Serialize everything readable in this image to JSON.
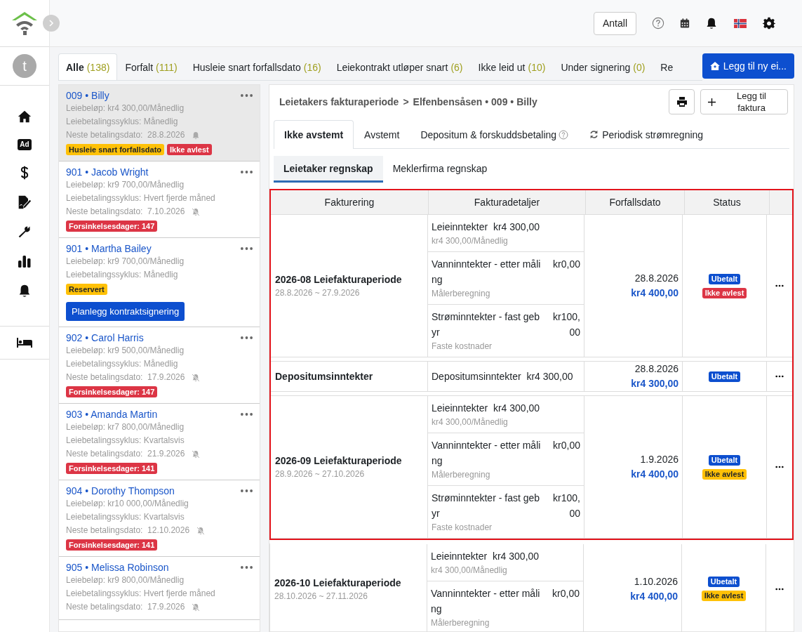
{
  "sidebar": {
    "avatar": "t",
    "ad_badge": "Ad"
  },
  "toolbar": {
    "count_button": "Antall"
  },
  "filter_tabs": [
    {
      "label": "Alle",
      "count": "(138)",
      "selected": true
    },
    {
      "label": "Forfalt",
      "count": "(111)",
      "selected": false
    },
    {
      "label": "Husleie snart forfallsdato",
      "count": "(16)",
      "selected": false
    },
    {
      "label": "Leiekontrakt utløper snart",
      "count": "(6)",
      "selected": false
    },
    {
      "label": "Ikke leid ut",
      "count": "(10)",
      "selected": false
    },
    {
      "label": "Under signering",
      "count": "(0)",
      "selected": false
    },
    {
      "label": "Re",
      "selected": false
    }
  ],
  "add_property_button": "Legg til ny ei...",
  "tenants": [
    {
      "title": "009 • Billy",
      "rent": "Leiebeløp: kr4 300,00/Månedlig",
      "cycle": "Leiebetalingssyklus: Månedlig",
      "next_payment": "Neste betalingsdato:  28.8.2026",
      "reminder": true,
      "selected": true,
      "tags": [
        {
          "label": "Husleie snart forfallsdato",
          "color": "#ffc107"
        },
        {
          "label": "Ikke avlest",
          "color": "#dc3545"
        }
      ]
    },
    {
      "title": "901 • Jacob Wright",
      "rent": "Leiebeløp: kr9 700,00/Månedlig",
      "cycle": "Leiebetalingssyklus: Hvert fjerde måned",
      "next_payment": "Neste betalingsdato:  7.10.2026",
      "reminder": false,
      "selected": false,
      "tags": [
        {
          "label": "Forsinkelsesdager: 147",
          "color": "#dc3545"
        }
      ]
    },
    {
      "title": "901 • Martha Bailey",
      "rent": "Leiebeløp: kr9 700,00/Månedlig",
      "cycle": "Leiebetalingssyklus: Månedlig",
      "selected": false,
      "tags": [
        {
          "label": "Reservert",
          "color": "#ffc107"
        }
      ],
      "action_button": "Planlegg kontraktsignering"
    },
    {
      "title": "902 • Carol Harris",
      "rent": "Leiebeløp: kr9 500,00/Månedlig",
      "cycle": "Leiebetalingssyklus: Månedlig",
      "next_payment": "Neste betalingsdato:  17.9.2026",
      "reminder": false,
      "selected": false,
      "tags": [
        {
          "label": "Forsinkelsesdager: 147",
          "color": "#dc3545"
        }
      ]
    },
    {
      "title": "903 • Amanda Martin",
      "rent": "Leiebeløp: kr7 800,00/Månedlig",
      "cycle": "Leiebetalingssyklus: Kvartalsvis",
      "next_payment": "Neste betalingsdato:  21.9.2026",
      "reminder": false,
      "selected": false,
      "tags": [
        {
          "label": "Forsinkelsesdager: 141",
          "color": "#dc3545"
        }
      ]
    },
    {
      "title": "904 • Dorothy Thompson",
      "rent": "Leiebeløp: kr10 000,00/Månedlig",
      "cycle": "Leiebetalingssyklus: Kvartalsvis",
      "next_payment": "Neste betalingsdato:  12.10.2026",
      "reminder": false,
      "selected": false,
      "tags": [
        {
          "label": "Forsinkelsesdager: 141",
          "color": "#dc3545"
        }
      ]
    },
    {
      "title": "905 • Melissa Robinson",
      "rent": "Leiebeløp: kr9 800,00/Månedlig",
      "cycle": "Leiebetalingssyklus: Hvert fjerde måned",
      "next_payment": "Neste betalingsdato:  17.9.2026",
      "reminder": false,
      "selected": false
    }
  ],
  "invoice_panel": {
    "breadcrumb": {
      "parent": "Leietakers fakturaperiode",
      "separator": ">",
      "current": "Elfenbensåsen • 009 • Billy"
    },
    "add_invoice_button": "Legg til faktura",
    "tabs": [
      {
        "label": "Ikke avstemt",
        "kind": "plain",
        "selected": true
      },
      {
        "label": "Avstemt",
        "kind": "plain",
        "selected": false
      },
      {
        "label": "Depositum & forskuddsbetaling",
        "kind": "help",
        "selected": false
      },
      {
        "label": "Periodisk strømregning",
        "kind": "refresh",
        "selected": false
      }
    ],
    "subtabs": [
      {
        "label": "Leietaker regnskap",
        "selected": true
      },
      {
        "label": "Meklerfirma regnskap",
        "selected": false
      }
    ],
    "table": {
      "columns": [
        "Fakturering",
        "Fakturadetaljer",
        "Forfallsdato",
        "Status"
      ],
      "groups": [
        {
          "title": "2026-08 Leiefakturaperiode",
          "period": "28.8.2026 ~ 27.9.2026",
          "highlighted": true,
          "due_date": "28.8.2026",
          "total": "kr4 400,00",
          "items": [
            {
              "kind": "inline",
              "label": "Leieinntekter",
              "amount": "kr4 300,00",
              "note": "kr4 300,00/Månedlig"
            },
            {
              "kind": "split",
              "label": "Vanninntekter - etter måling",
              "amount": "kr0,00",
              "note": "Målerberegning"
            },
            {
              "kind": "split",
              "label": "Strøminntekter - fast gebyr",
              "amount": "kr100,00",
              "note": "Faste kostnader"
            }
          ],
          "statuses": [
            {
              "label": "Ubetalt",
              "color": "#0d4fcf"
            },
            {
              "label": "Ikke avlest",
              "color": "#dc3545"
            }
          ]
        },
        {
          "title": "Depositumsinntekter",
          "highlighted": true,
          "due_date": "28.8.2026",
          "total": "kr4 300,00",
          "items": [
            {
              "kind": "inline",
              "label": "Depositumsinntekter",
              "amount": "kr4 300,00"
            }
          ],
          "statuses": [
            {
              "label": "Ubetalt",
              "color": "#0d4fcf"
            }
          ]
        },
        {
          "title": "2026-09 Leiefakturaperiode",
          "period": "28.9.2026 ~ 27.10.2026",
          "highlighted": true,
          "due_date": "1.9.2026",
          "total": "kr4 400,00",
          "items": [
            {
              "kind": "inline",
              "label": "Leieinntekter",
              "amount": "kr4 300,00",
              "note": "kr4 300,00/Månedlig"
            },
            {
              "kind": "split",
              "label": "Vanninntekter - etter måling",
              "amount": "kr0,00",
              "note": "Målerberegning"
            },
            {
              "kind": "split",
              "label": "Strøminntekter - fast gebyr",
              "amount": "kr100,00",
              "note": "Faste kostnader"
            }
          ],
          "statuses": [
            {
              "label": "Ubetalt",
              "color": "#0d4fcf"
            },
            {
              "label": "Ikke avlest",
              "color": "#ffc107"
            }
          ]
        },
        {
          "title": "2026-10 Leiefakturaperiode",
          "period": "28.10.2026 ~ 27.11.2026",
          "highlighted": false,
          "due_date": "1.10.2026",
          "total": "kr4 400,00",
          "items": [
            {
              "kind": "inline",
              "label": "Leieinntekter",
              "amount": "kr4 300,00",
              "note": "kr4 300,00/Månedlig"
            },
            {
              "kind": "split",
              "label": "Vanninntekter - etter måling",
              "amount": "kr0,00",
              "note": "Målerberegning"
            }
          ],
          "statuses": [
            {
              "label": "Ubetalt",
              "color": "#0d4fcf"
            },
            {
              "label": "Ikke avlest",
              "color": "#ffc107"
            }
          ]
        }
      ]
    }
  }
}
